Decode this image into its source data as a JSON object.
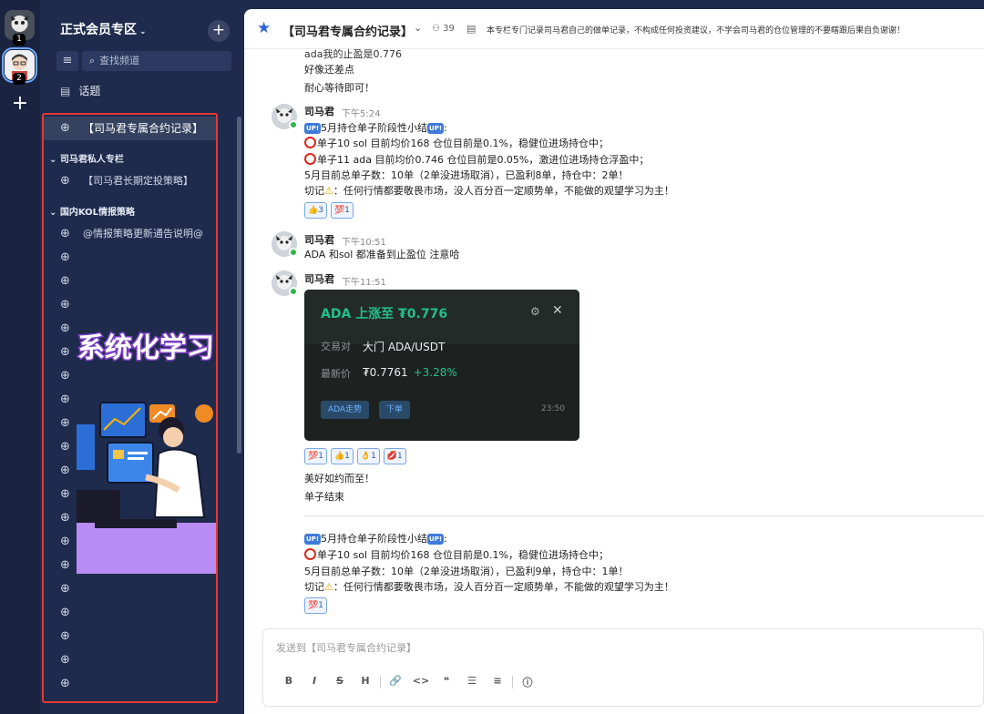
{
  "rail": {
    "badge1": "1",
    "badge2": "2",
    "add": "+"
  },
  "sidebar": {
    "workspace_title": "正式会员专区",
    "workspace_chevron": "⌄",
    "add": "+",
    "filter_icon": "≡",
    "search_placeholder": "查找频道",
    "topic": "话题",
    "channels": [
      {
        "label": "【司马君专属合约记录】",
        "active": true
      },
      {
        "label": "【司马君长期定投策略】"
      },
      {
        "label": "@情报策略更新通告说明@"
      }
    ],
    "categories": [
      "司马君私人专栏",
      "国内KOL情报策略"
    ],
    "promo_text": "系统化学习"
  },
  "header": {
    "title": "【司马君专属合约记录】",
    "member_count": "39",
    "description": "本专栏专门记录司马君自己的做单记录，不构成任何投资建议，不学会司马君的仓位管理的不要瞎跟后果自负谢谢！"
  },
  "messages": {
    "top_lines": [
      "ada我的止盈是0.776",
      "好像还差点",
      "耐心等待即可！"
    ],
    "m1": {
      "author": "司马君",
      "time": "下午5:24",
      "line1": "5月持仓单子阶段性小结",
      "line2": "单子10  sol   目前均价168   仓位目前是0.1%，稳健位进场持仓中；",
      "line3": "单子11  ada   目前均价0.746   仓位目前是0.05%，激进位进场持仓浮盈中；",
      "line4": "5月目前总单子数：10单（2单没进场取消），已盈利8单，持仓中：2单！",
      "line5a": "切记",
      "line5b": "：任何行情都要敬畏市场，没人百分百一定顺势单，不能做的观望学习为主！",
      "reactions": [
        "👍3",
        "💯1"
      ]
    },
    "m2": {
      "author": "司马君",
      "time": "下午10:51",
      "text": "ADA 和sol 都准备到止盈位 注意哈"
    },
    "m3": {
      "author": "司马君",
      "time": "下午11:51",
      "card": {
        "title": "ADA 上涨至 ₮0.776",
        "pair_label": "交易对",
        "pair_value": "大门 ADA/USDT",
        "price_label": "最新价",
        "price_value": "₮0.7761",
        "change": "+3.28%",
        "btn_trend": "ADA走势",
        "btn_order": "下单",
        "time": "23:50"
      },
      "reactions": [
        "💯1",
        "👍1",
        "👌1",
        "💋1"
      ],
      "after1": "美好如约而至！",
      "after2": "单子结束"
    },
    "m4": {
      "line1": "5月持仓单子阶段性小结",
      "line2": "单子10  sol   目前均价168   仓位目前是0.1%，稳健位进场持仓中；",
      "line3": "5月目前总单子数：10单（2单没进场取消），已盈利9单，持仓中：1单！",
      "line4a": "切记",
      "line4b": "：任何行情都要敬畏市场，没人百分百一定顺势单，不能做的观望学习为主！",
      "reactions": [
        "💯1"
      ]
    },
    "up_badge": "UP!"
  },
  "composer": {
    "placeholder": "发送到【司马君专属合约记录】",
    "tools": [
      "B",
      "I",
      "S",
      "H",
      "🔗",
      "<>",
      "❝",
      "☰",
      "≡",
      "ⓘ"
    ]
  }
}
